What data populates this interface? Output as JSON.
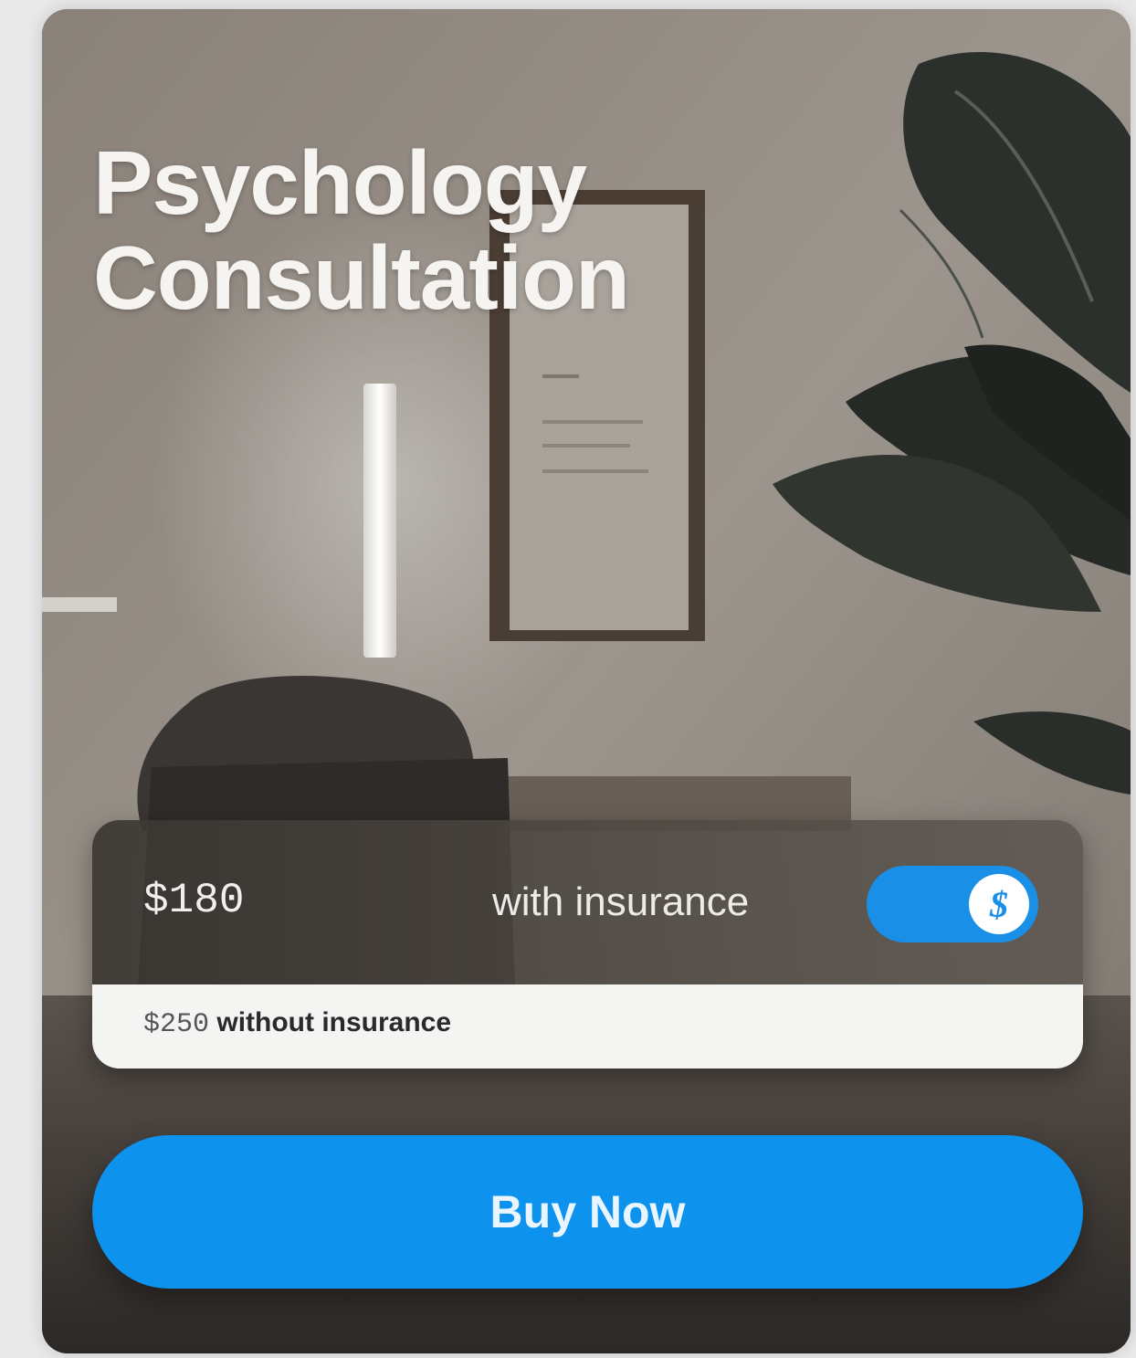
{
  "card": {
    "title_line1": "Psychology",
    "title_line2": "Consultation"
  },
  "pricing": {
    "price": "$180",
    "insurance_label": "with insurance",
    "insurance_enabled": true,
    "toggle_icon": "dollar-sign-icon",
    "toggle_glyph": "$",
    "alt_price_amount": "$250",
    "alt_price_text": "without insurance"
  },
  "actions": {
    "buy_label": "Buy Now"
  },
  "colors": {
    "accent": "#0d93ee",
    "panel_dark": "#3a3632",
    "panel_light": "#f4f4f3"
  }
}
